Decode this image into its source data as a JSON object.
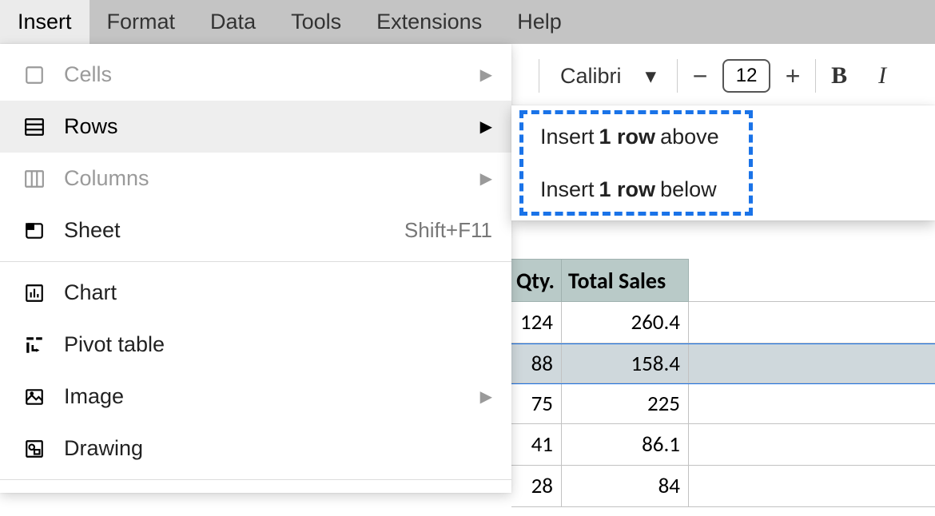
{
  "menubar": {
    "items": [
      {
        "label": "Insert",
        "active": true
      },
      {
        "label": "Format"
      },
      {
        "label": "Data"
      },
      {
        "label": "Tools"
      },
      {
        "label": "Extensions"
      },
      {
        "label": "Help"
      }
    ]
  },
  "toolbar": {
    "font_name": "Calibri",
    "font_size": "12"
  },
  "insert_menu": {
    "items": [
      {
        "icon": "cells-icon",
        "label": "Cells",
        "submenu": true,
        "disabled": true
      },
      {
        "icon": "rows-icon",
        "label": "Rows",
        "submenu": true,
        "highlight": true
      },
      {
        "icon": "columns-icon",
        "label": "Columns",
        "submenu": true,
        "disabled": true
      },
      {
        "icon": "sheet-icon",
        "label": "Sheet",
        "shortcut": "Shift+F11"
      },
      {
        "sep": true
      },
      {
        "icon": "chart-icon",
        "label": "Chart"
      },
      {
        "icon": "pivot-icon",
        "label": "Pivot table"
      },
      {
        "icon": "image-icon",
        "label": "Image",
        "submenu": true,
        "disabled_chevron": true
      },
      {
        "icon": "drawing-icon",
        "label": "Drawing"
      }
    ]
  },
  "rows_submenu": {
    "items": [
      {
        "prefix": "Insert",
        "bold": "1 row",
        "suffix": "above"
      },
      {
        "prefix": "Insert",
        "bold": "1 row",
        "suffix": "below"
      }
    ]
  },
  "sheet_headers": {
    "qty": "Qty.",
    "total": "Total Sales"
  },
  "sheet_rows": [
    {
      "qty": "124",
      "total": "260.4"
    },
    {
      "qty": "88",
      "total": "158.4",
      "selected": true
    },
    {
      "qty": "75",
      "total": "225"
    },
    {
      "qty": "41",
      "total": "86.1"
    },
    {
      "qty": "28",
      "total": "84"
    }
  ]
}
